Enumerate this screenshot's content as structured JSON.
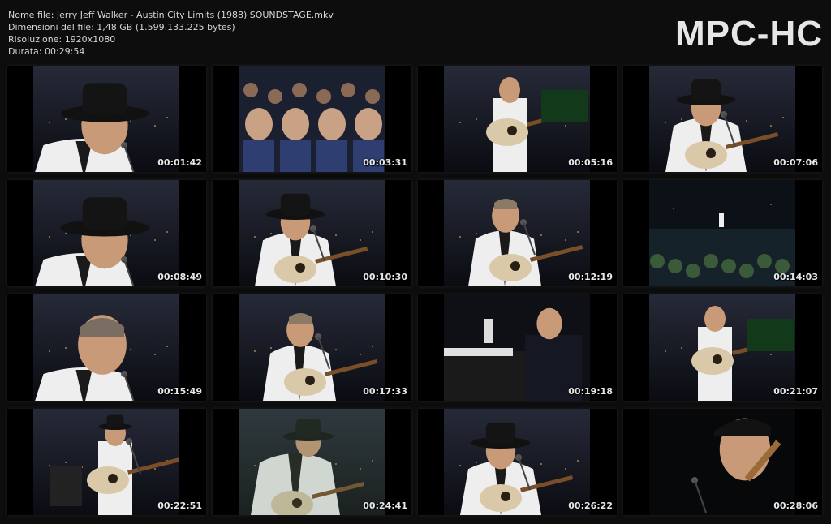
{
  "info": {
    "filename": "Nome file: Jerry Jeff Walker - Austin City Limits (1988) SOUNDSTAGE.mkv",
    "filesize": "Dimensioni del file: 1,48 GB (1.599.133.225 bytes)",
    "resolution": "Risoluzione: 1920x1080",
    "duration": "Durata: 00:29:54"
  },
  "brand": "MPC-HC",
  "thumbnails": [
    {
      "time": "00:01:42",
      "scene": "singer-hat-closeup"
    },
    {
      "time": "00:03:31",
      "scene": "audience-clapping"
    },
    {
      "time": "00:05:16",
      "scene": "guitarist-standing-white-suit"
    },
    {
      "time": "00:07:06",
      "scene": "singer-hat-guitar"
    },
    {
      "time": "00:08:49",
      "scene": "singer-hat-closeup"
    },
    {
      "time": "00:10:30",
      "scene": "singer-hat-guitar"
    },
    {
      "time": "00:12:19",
      "scene": "guitarist-white-jacket"
    },
    {
      "time": "00:14:03",
      "scene": "wide-stage"
    },
    {
      "time": "00:15:49",
      "scene": "singer-no-hat-closeup"
    },
    {
      "time": "00:17:33",
      "scene": "guitarist-white-jacket"
    },
    {
      "time": "00:19:18",
      "scene": "pianist"
    },
    {
      "time": "00:21:07",
      "scene": "guitarist-standing-white-suit"
    },
    {
      "time": "00:22:51",
      "scene": "band-on-stage"
    },
    {
      "time": "00:24:41",
      "scene": "singer-hat-guitar-overlay"
    },
    {
      "time": "00:26:22",
      "scene": "singer-hat-guitar"
    },
    {
      "time": "00:28:06",
      "scene": "singer-closeup-mic"
    }
  ]
}
